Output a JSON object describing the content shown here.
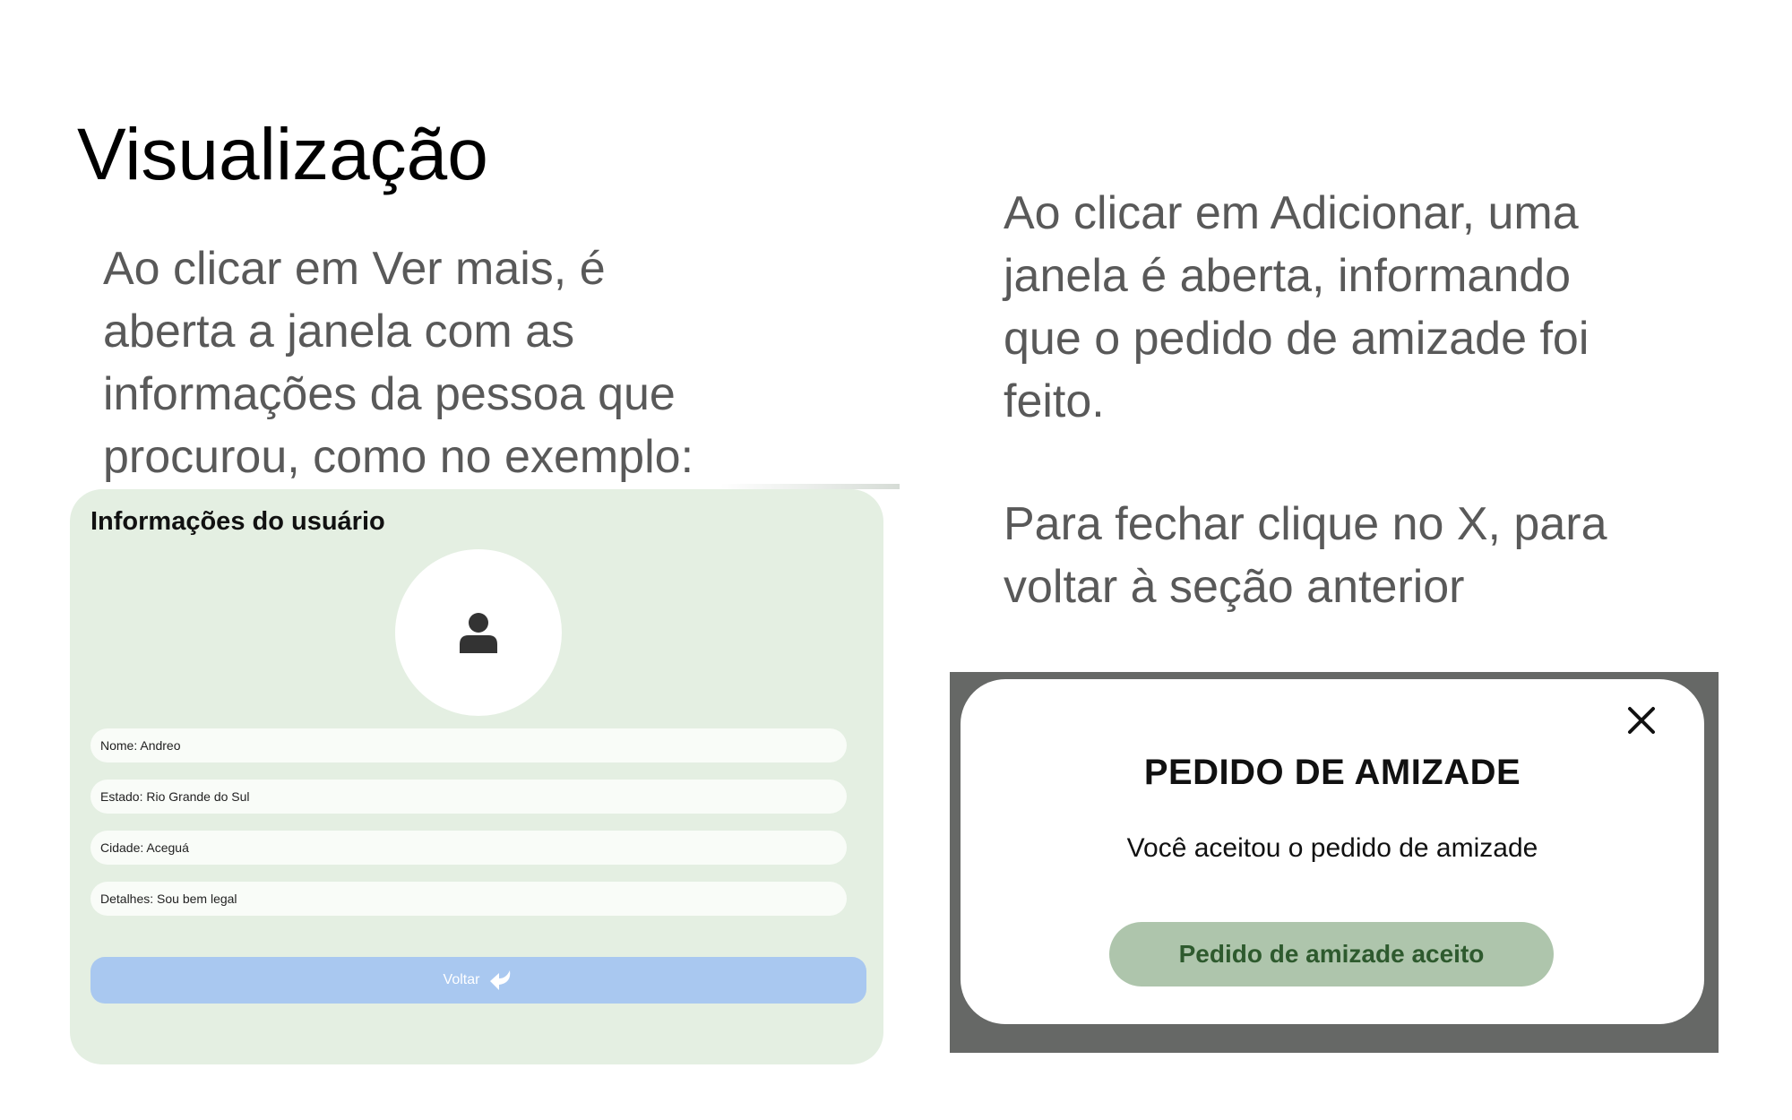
{
  "slide": {
    "title": "Visualização",
    "left_text": [
      "Ao clicar em Ver mais, é",
      "aberta a janela com as",
      "informações da pessoa que",
      "procurou, como no exemplo:"
    ],
    "right_text_1": [
      "Ao clicar em Adicionar, uma",
      "janela é aberta, informando",
      "que o pedido de amizade foi",
      "feito."
    ],
    "right_text_2": [
      "Para fechar clique no X, para",
      "voltar à seção anterior"
    ]
  },
  "user_card": {
    "title": "Informações do usuário",
    "avatar_icon": "person-icon",
    "fields": {
      "nome": "Nome: Andreo",
      "estado": "Estado: Rio Grande do Sul",
      "cidade": "Cidade: Aceguá",
      "detalhes": "Detalhes: Sou bem legal"
    },
    "back_button": "Voltar",
    "back_icon": "return-arrow-icon"
  },
  "friend_modal": {
    "close_icon": "close-icon",
    "title": "PEDIDO DE AMIZADE",
    "message": "Você aceitou o pedido de amizade",
    "button": "Pedido de amizade aceito"
  },
  "colors": {
    "card_bg": "#e4efe2",
    "back_button": "#a9c8f0",
    "modal_overlay": "#666866",
    "accepted_button": "#aec5ac",
    "accepted_text": "#2e5a2e"
  }
}
